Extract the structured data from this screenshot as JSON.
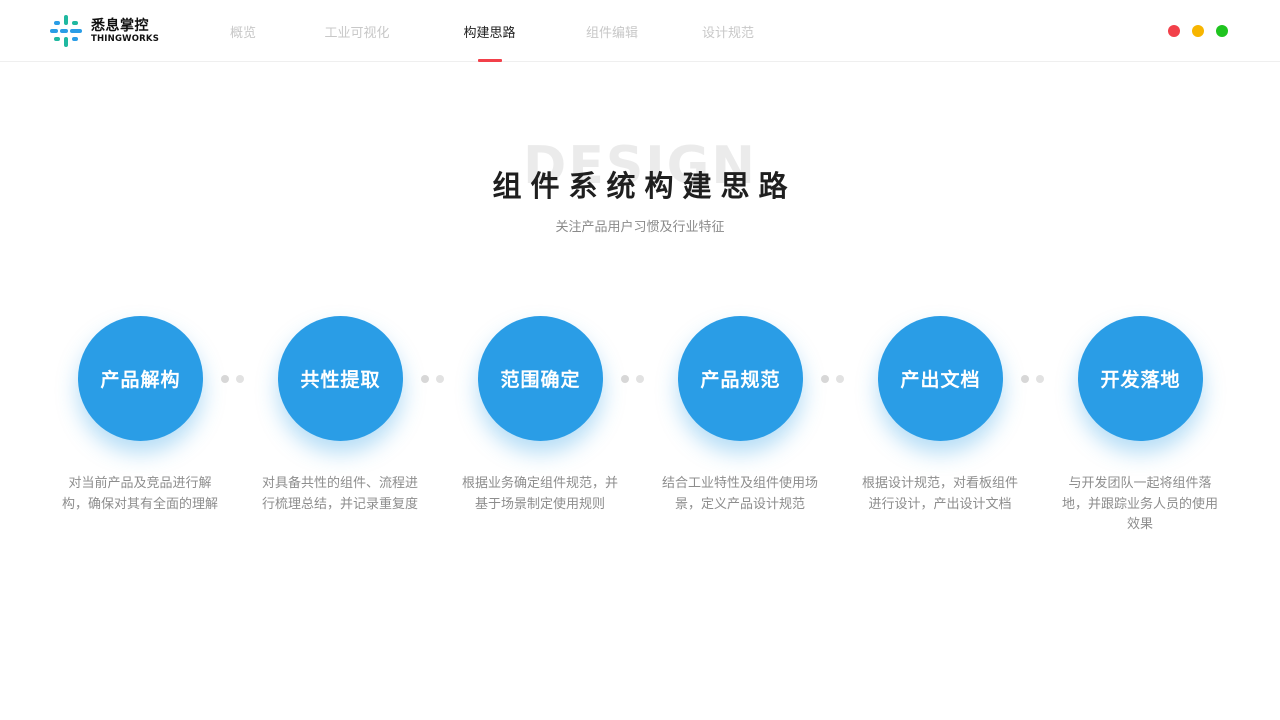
{
  "brand": {
    "name_cn": "悉息掌控",
    "name_en": "THINGWORKS"
  },
  "nav": {
    "items": [
      {
        "label": "概览",
        "active": false
      },
      {
        "label": "工业可视化",
        "active": false
      },
      {
        "label": "构建思路",
        "active": true
      },
      {
        "label": "组件编辑",
        "active": false
      },
      {
        "label": "设计规范",
        "active": false
      }
    ]
  },
  "window_dots": {
    "colors": [
      "#f2404a",
      "#f7b500",
      "#1fc41f"
    ]
  },
  "hero": {
    "watermark": "DESIGN",
    "title": "组件系统构建思路",
    "subtitle": "关注产品用户习惯及行业特征"
  },
  "colors": {
    "accent": "#2a9de6",
    "nav_indicator": "#f2404a"
  },
  "steps": [
    {
      "label": "产品解构",
      "desc": "对当前产品及竞品进行解构，确保对其有全面的理解"
    },
    {
      "label": "共性提取",
      "desc": "对具备共性的组件、流程进行梳理总结，并记录重复度"
    },
    {
      "label": "范围确定",
      "desc": "根据业务确定组件规范，并基于场景制定使用规则"
    },
    {
      "label": "产品规范",
      "desc": "结合工业特性及组件使用场景，定义产品设计规范"
    },
    {
      "label": "产出文档",
      "desc": "根据设计规范，对看板组件进行设计，产出设计文档"
    },
    {
      "label": "开发落地",
      "desc": "与开发团队一起将组件落地，并跟踪业务人员的使用效果"
    }
  ]
}
